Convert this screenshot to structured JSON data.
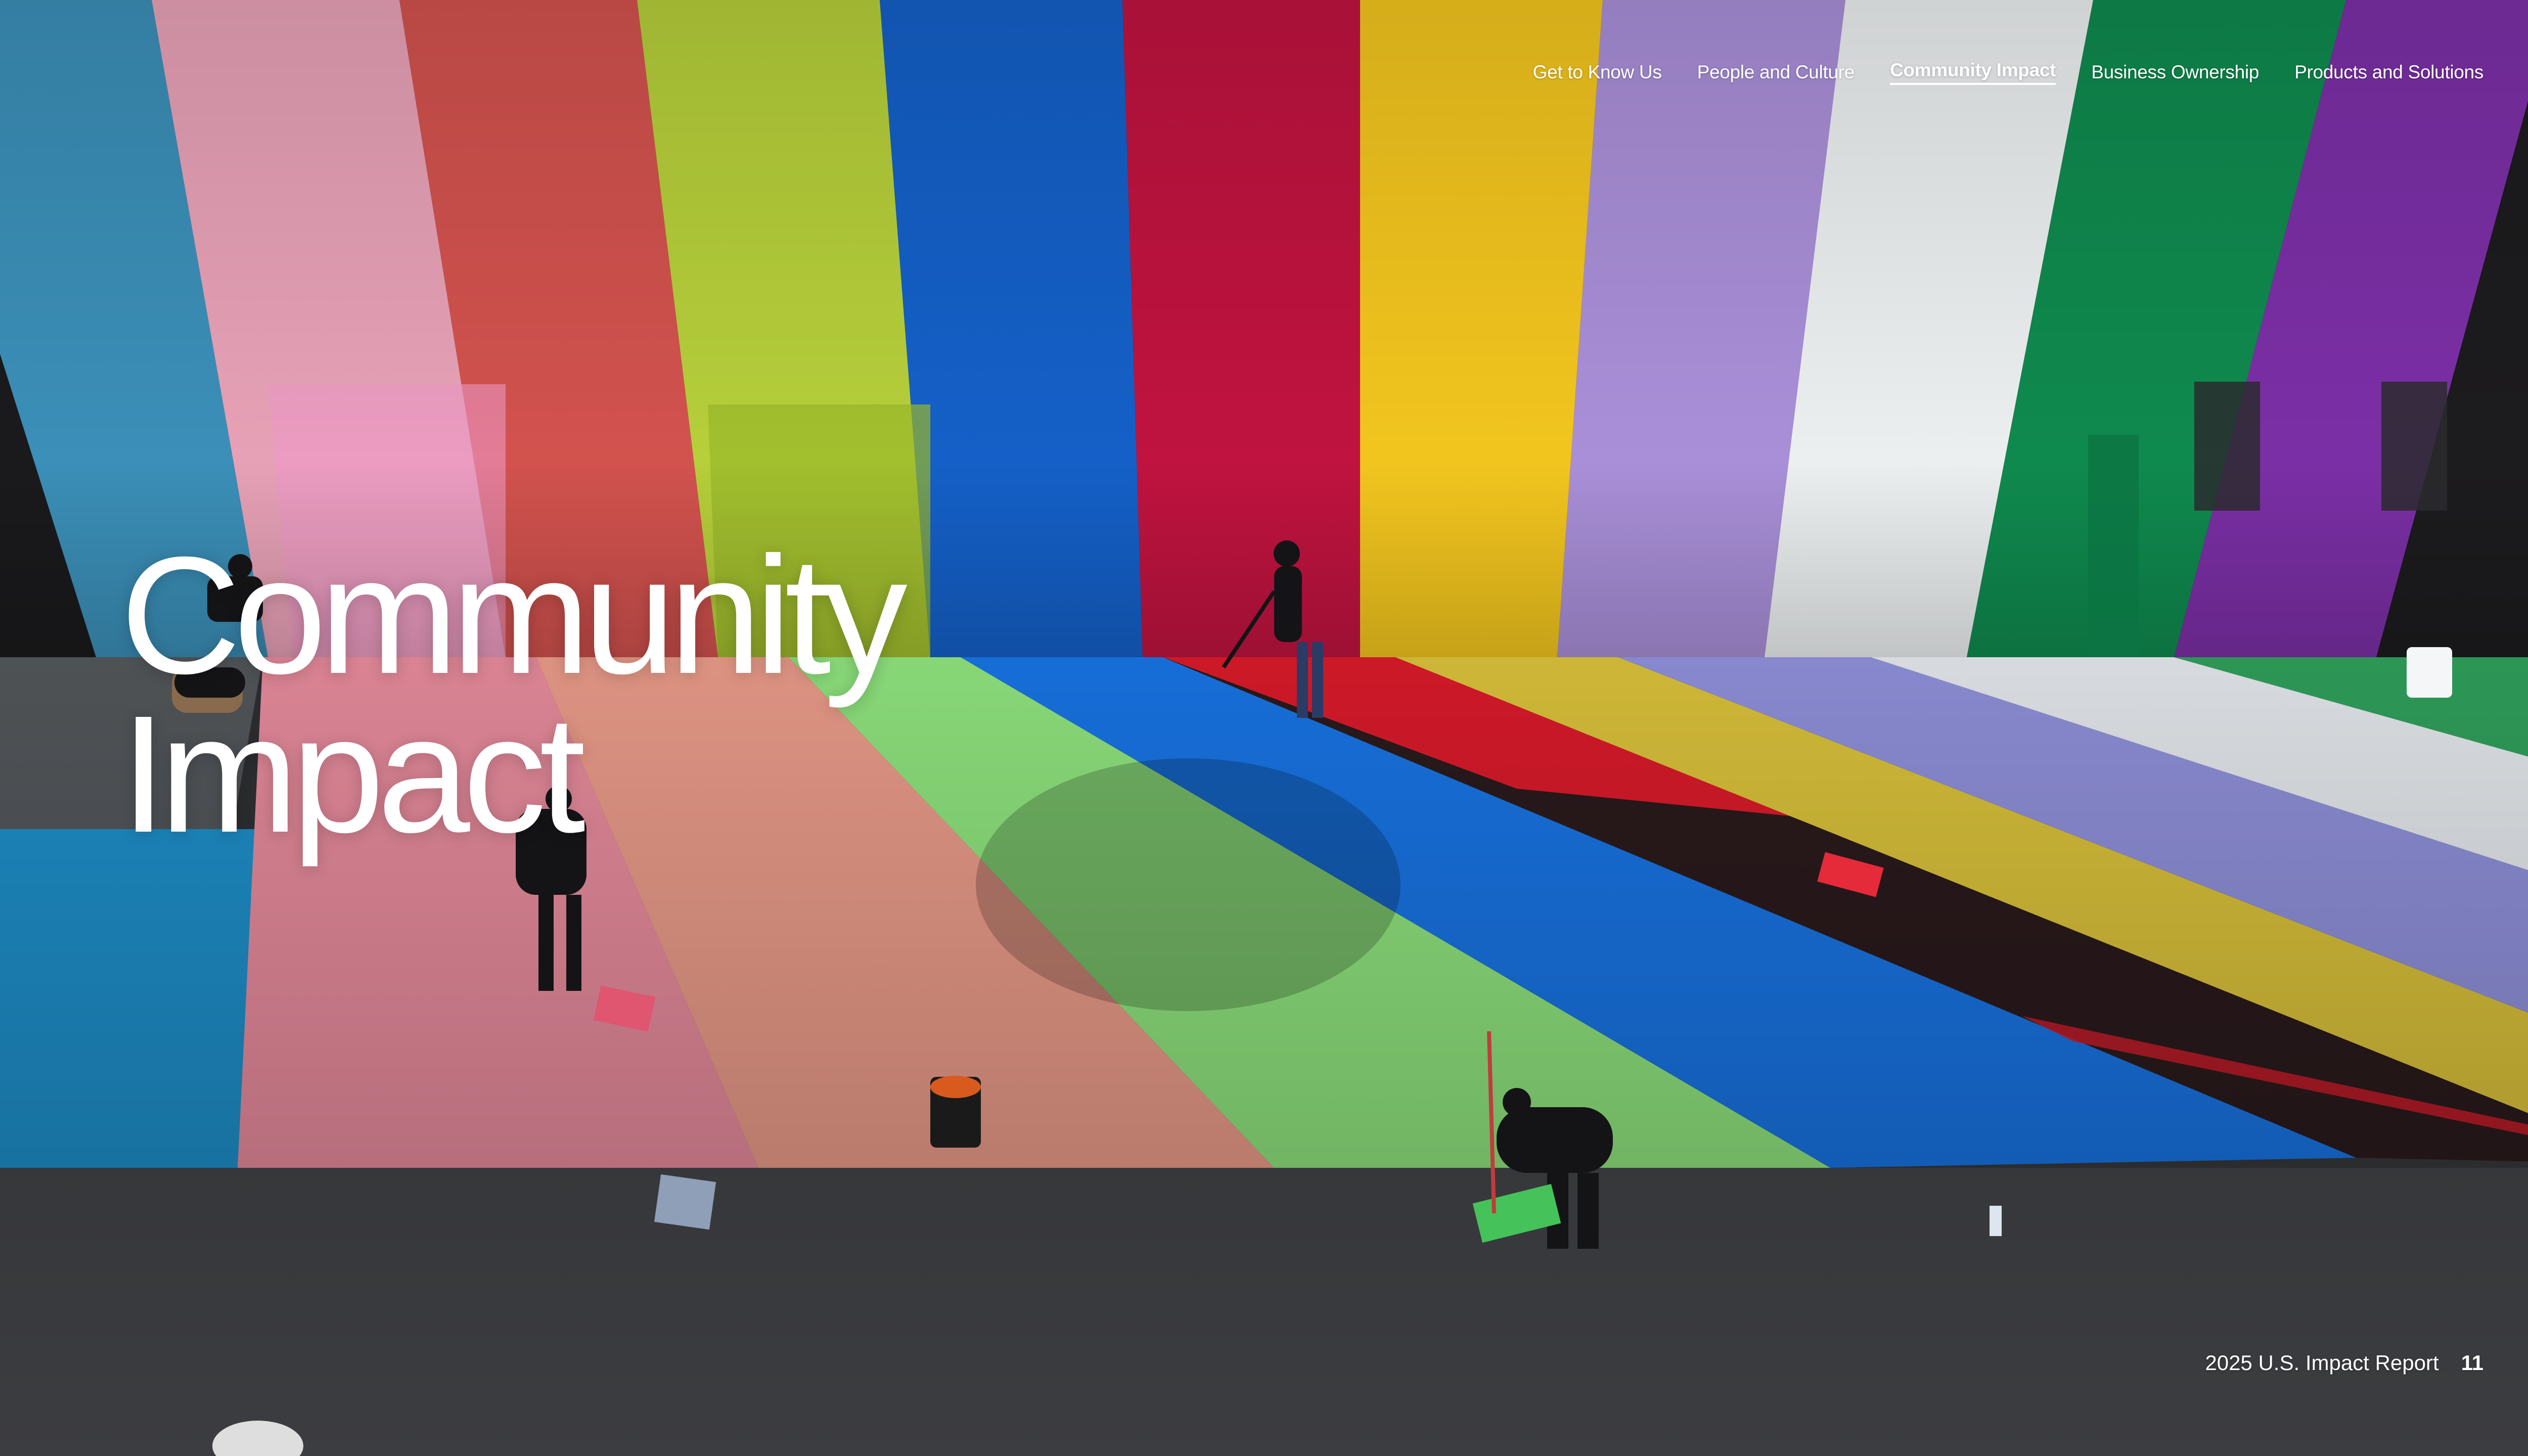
{
  "nav": {
    "items": [
      {
        "label": "Get to Know Us",
        "active": false
      },
      {
        "label": "People and Culture",
        "active": false
      },
      {
        "label": "Community Impact",
        "active": true
      },
      {
        "label": "Business Ownership",
        "active": false
      },
      {
        "label": "Products and Solutions",
        "active": false
      }
    ]
  },
  "title": {
    "line1": "Community",
    "line2": "Impact"
  },
  "footer": {
    "report_name": "2025 U.S. Impact Report",
    "page_number": "11"
  },
  "colors": {
    "text": "#ffffff",
    "wall_stripes": [
      "#3b8fb8",
      "#e7a1b6",
      "#d2524e",
      "#b6cf3a",
      "#1460c8",
      "#c0133f",
      "#f2c51e",
      "#a98fd8",
      "#eceff0",
      "#0f8a4e",
      "#7b2fa6"
    ],
    "ground_stripes": [
      "#1e8ec8",
      "#e58a9b",
      "#e89a88",
      "#8ee27d",
      "#1873e2",
      "#2a1a1c",
      "#d8c03a",
      "#8e8fd8",
      "#e2e6ea"
    ]
  },
  "photo": {
    "subject": "volunteers-painting-rainbow-mural"
  }
}
